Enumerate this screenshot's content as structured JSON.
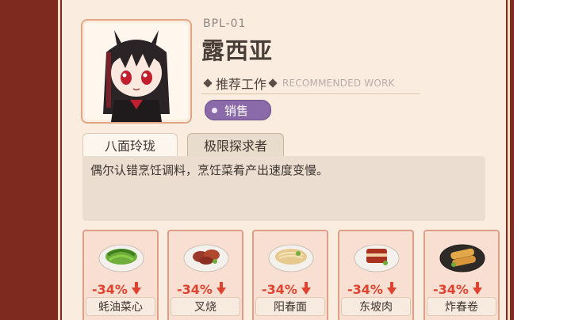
{
  "character": {
    "code": "BPL-01",
    "name": "露西亚",
    "recommended_work_zh": "推荐工作",
    "recommended_work_en": "RECOMMENDED WORK",
    "work_badge": "销售"
  },
  "tabs": [
    {
      "label": "八面玲珑",
      "active": false
    },
    {
      "label": "极限探求者",
      "active": true
    }
  ],
  "description": "偶尔认错烹饪调料，烹饪菜肴产出速度变慢。",
  "dishes": [
    {
      "name": "蚝油菜心",
      "modifier": "-34%",
      "icon": "greens-dish-icon"
    },
    {
      "name": "叉烧",
      "modifier": "-34%",
      "icon": "char-siu-dish-icon"
    },
    {
      "name": "阳春面",
      "modifier": "-34%",
      "icon": "noodle-bowl-icon"
    },
    {
      "name": "东坡肉",
      "modifier": "-34%",
      "icon": "braised-pork-icon"
    },
    {
      "name": "炸春卷",
      "modifier": "-34%",
      "icon": "spring-roll-icon"
    }
  ],
  "colors": {
    "frame": "#7f2a1f",
    "panel": "#fbece0",
    "badge": "#8b6aa9",
    "debuff": "#e0422f"
  }
}
